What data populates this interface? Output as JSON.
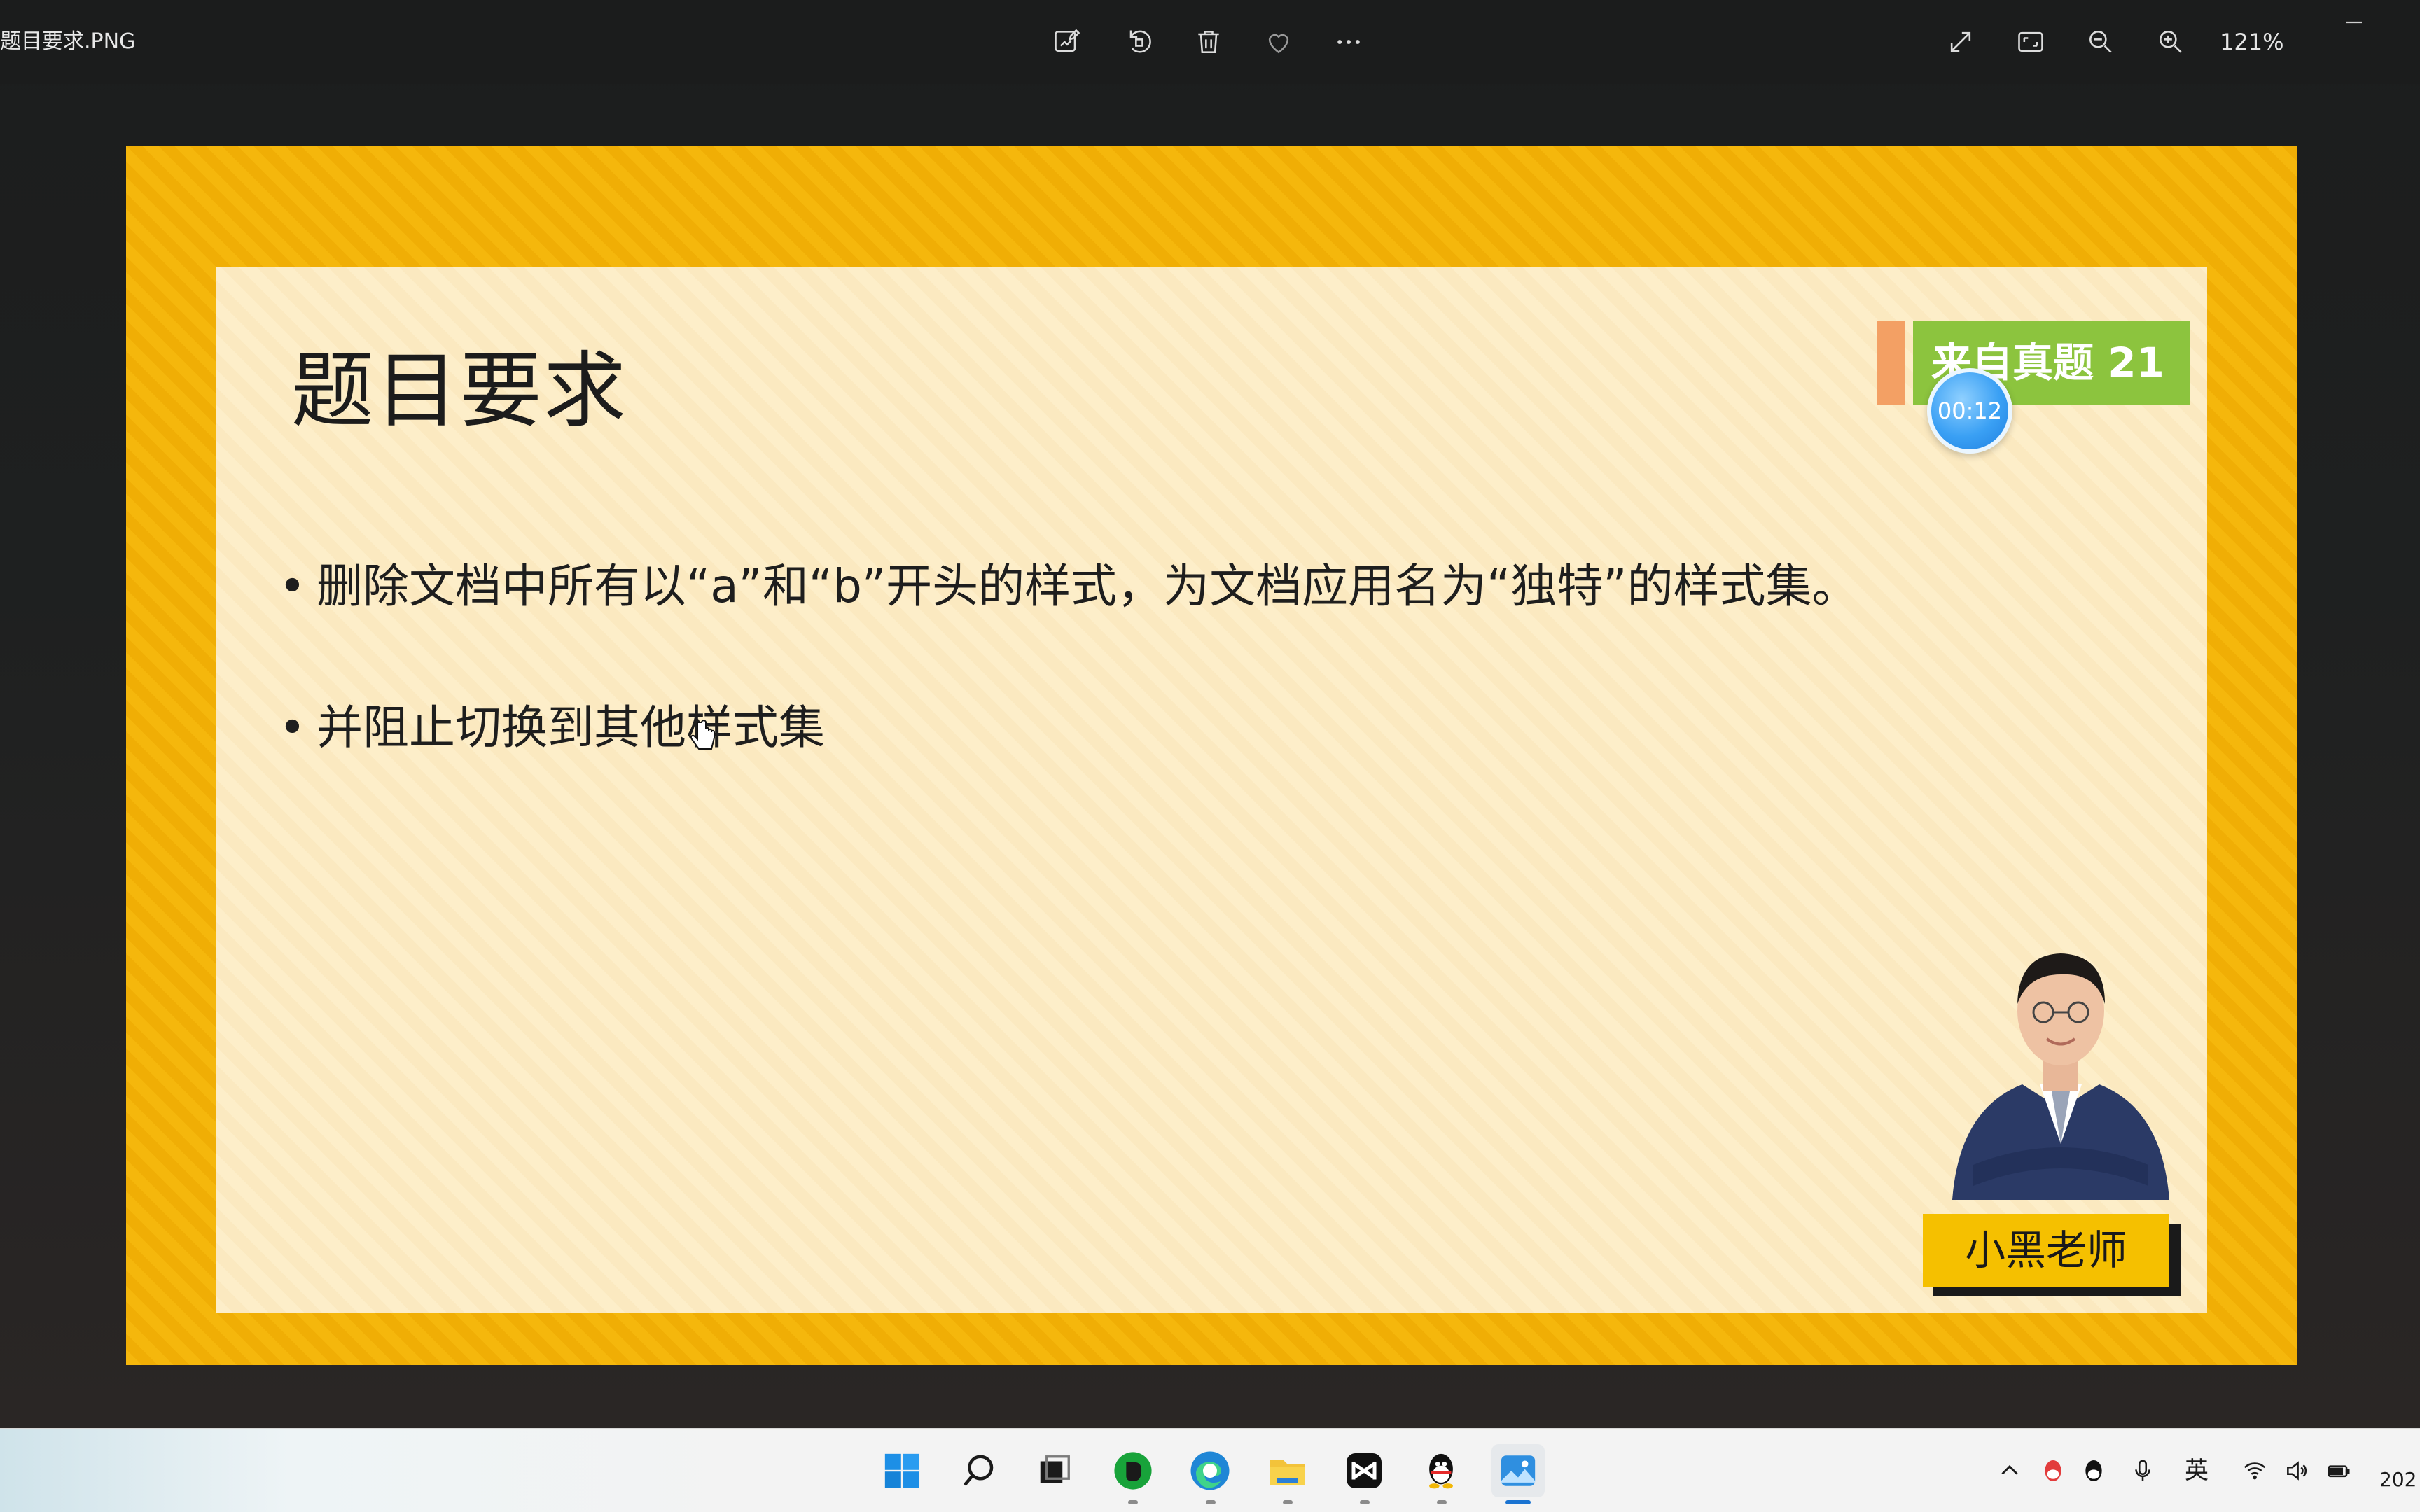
{
  "window": {
    "file_name": "题目要求.PNG",
    "zoom": "121%",
    "toolbar": [
      {
        "name": "edit-image-icon"
      },
      {
        "name": "rotate-icon"
      },
      {
        "name": "delete-icon"
      },
      {
        "name": "favorite-heart-icon"
      },
      {
        "name": "more-options-icon"
      },
      {
        "name": "fullscreen-icon"
      },
      {
        "name": "fit-to-window-icon"
      },
      {
        "name": "zoom-out-icon"
      },
      {
        "name": "zoom-in-icon"
      }
    ]
  },
  "slide": {
    "title": "题目要求",
    "bullets": [
      "删除文档中所有以“a”和“b”开头的样式，为文档应用名为“独特”的样式集。",
      "并阻止切换到其他样式集"
    ],
    "badge": "来自真题 21",
    "timer": "00:12",
    "presenter_name": "小黑老师",
    "colors": {
      "frame": "#f5b70c",
      "panel": "#fdeec9",
      "badge_green": "#8cc43e",
      "badge_orange": "#f3a064",
      "name_plate": "#f5c000"
    }
  },
  "taskbar": {
    "apps": [
      {
        "name": "start-icon"
      },
      {
        "name": "search-icon"
      },
      {
        "name": "task-view-icon"
      },
      {
        "name": "evernote-icon"
      },
      {
        "name": "edge-icon"
      },
      {
        "name": "file-explorer-icon"
      },
      {
        "name": "capcut-icon"
      },
      {
        "name": "qq-icon"
      },
      {
        "name": "photos-icon"
      }
    ],
    "tray": {
      "input_method": "英",
      "clock": "202"
    }
  }
}
